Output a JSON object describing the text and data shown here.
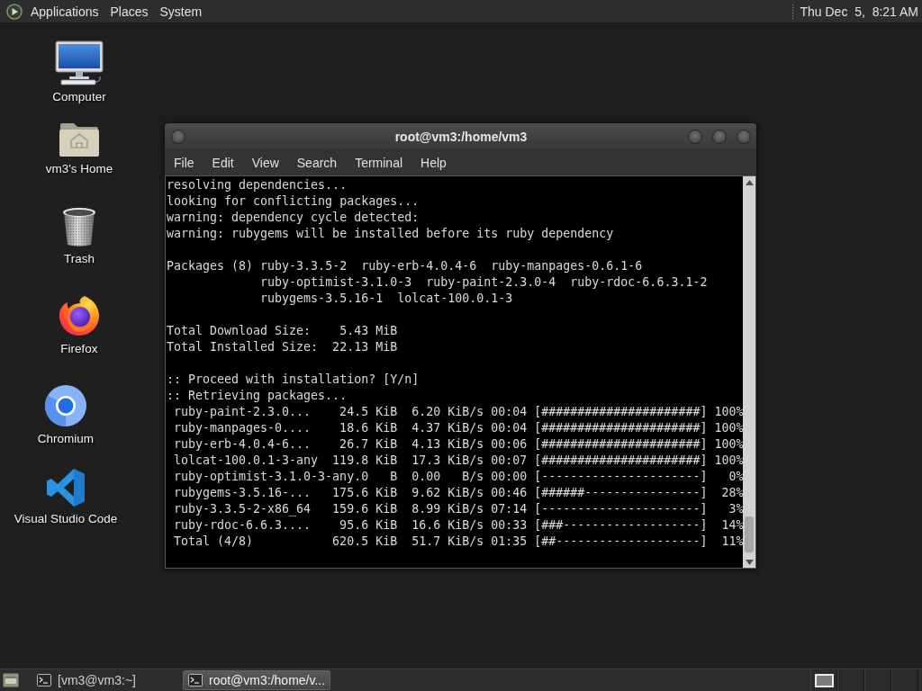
{
  "top_panel": {
    "menus": [
      "Applications",
      "Places",
      "System"
    ],
    "clock": "Thu Dec  5,  8:21 AM"
  },
  "desktop_icons": [
    "Computer",
    "vm3's Home",
    "Trash",
    "Firefox",
    "Chromium",
    "Visual Studio Code"
  ],
  "terminal_window": {
    "title": "root@vm3:/home/vm3",
    "menus": [
      "File",
      "Edit",
      "View",
      "Search",
      "Terminal",
      "Help"
    ],
    "output": [
      {
        "lines": [
          "resolving dependencies...",
          "looking for conflicting packages...",
          "warning: dependency cycle detected:",
          "warning: rubygems will be installed before its ruby dependency"
        ]
      },
      {
        "label": "Packages (8)",
        "lines": [
          "ruby-3.3.5-2  ruby-erb-4.0.4-6  ruby-manpages-0.6.1-6",
          "ruby-optimist-3.1.0-3  ruby-paint-2.3.0-4  ruby-rdoc-6.6.3.1-2",
          "rubygems-3.5.16-1  lolcat-100.0.1-3"
        ]
      },
      {
        "lines": [
          "Total Download Size:    5.43 MiB",
          "Total Installed Size:  22.13 MiB"
        ]
      },
      {
        "lines": [
          ":: Proceed with installation? [Y/n]",
          ":: Retrieving packages..."
        ],
        "transfers": [
          "ruby-paint-2.3.0...    24.5 KiB  6.20 KiB/s 00:04 [######################] 100%",
          "ruby-manpages-0....    18.6 KiB  4.37 KiB/s 00:04 [######################] 100%",
          "ruby-erb-4.0.4-6...    26.7 KiB  4.13 KiB/s 00:06 [######################] 100%",
          "lolcat-100.0.1-3-any  119.8 KiB  17.3 KiB/s 00:07 [######################] 100%",
          "ruby-optimist-3.1.0-3-any.0   B  0.00   B/s 00:00 [----------------------]   0%",
          "rubygems-3.5.16-...   175.6 KiB  9.62 KiB/s 00:46 [######----------------]  28%",
          "ruby-3.3.5-2-x86_64   159.6 KiB  8.99 KiB/s 07:14 [----------------------]   3%",
          "ruby-rdoc-6.6.3....    95.6 KiB  16.6 KiB/s 00:33 [###-------------------]  14%",
          "Total (4/8)           620.5 KiB  51.7 KiB/s 01:35 [##--------------------]  11%"
        ]
      }
    ]
  },
  "taskbar": {
    "tasks": [
      {
        "label": "[vm3@vm3:~]",
        "selected": false
      },
      {
        "label": "root@vm3:/home/v...",
        "selected": true
      }
    ]
  }
}
